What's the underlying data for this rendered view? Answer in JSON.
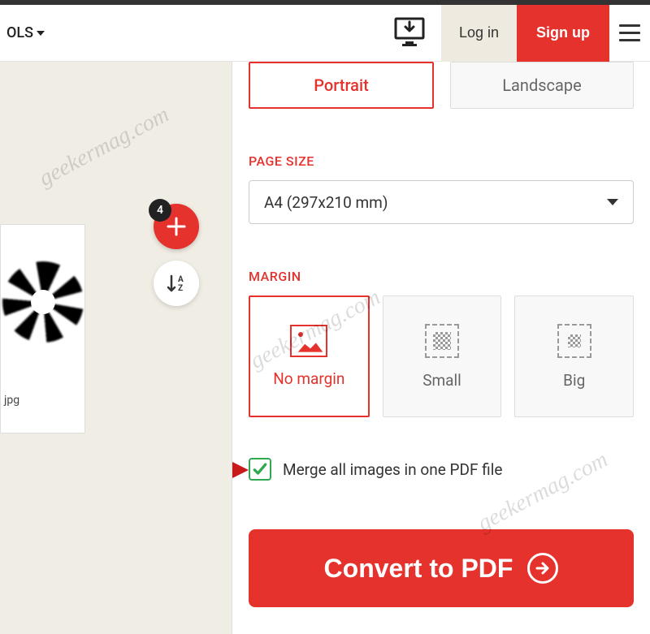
{
  "header": {
    "tools_label": "OLS",
    "login_label": "Log in",
    "signup_label": "Sign up"
  },
  "sidebar": {
    "thumb_filename": "jpg",
    "add_badge_count": "4"
  },
  "orientation": {
    "items": [
      {
        "label": "Portrait",
        "selected": true
      },
      {
        "label": "Landscape",
        "selected": false
      }
    ]
  },
  "page_size": {
    "section_label": "PAGE SIZE",
    "selected": "A4 (297x210 mm)"
  },
  "margin": {
    "section_label": "MARGIN",
    "items": [
      {
        "label": "No margin",
        "selected": true
      },
      {
        "label": "Small",
        "selected": false
      },
      {
        "label": "Big",
        "selected": false
      }
    ]
  },
  "merge": {
    "label": "Merge all images in one PDF file",
    "checked": true
  },
  "convert": {
    "label": "Convert to PDF"
  },
  "watermark": "geekermag.com"
}
